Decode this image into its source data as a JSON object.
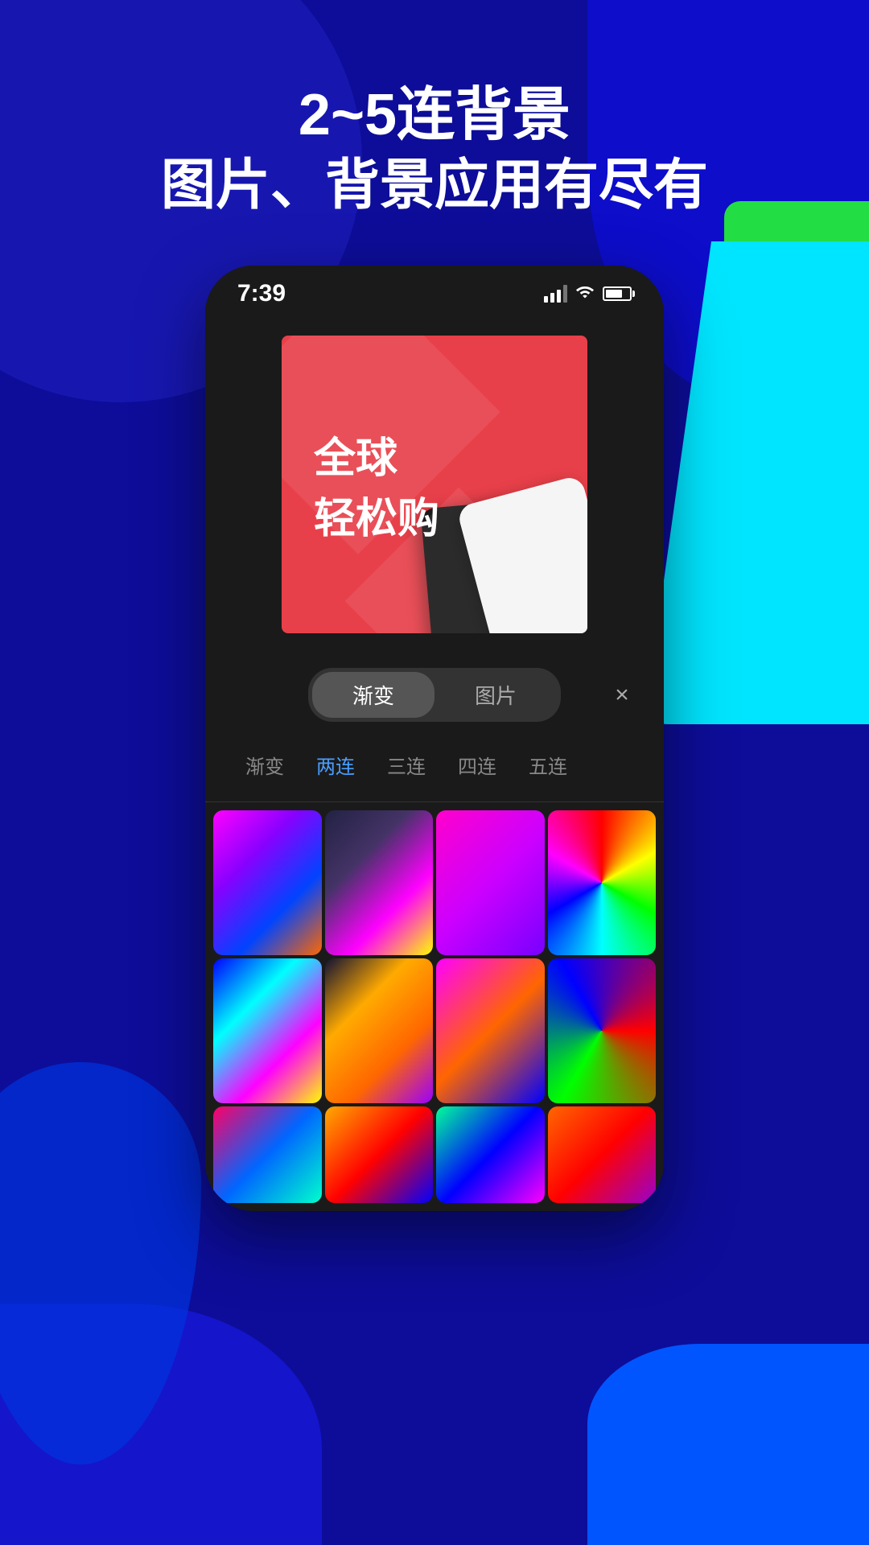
{
  "background": {
    "color": "#0d0d99"
  },
  "headline": {
    "line1": "2~5连背景",
    "line2": "图片、背景应用有尽有"
  },
  "phone": {
    "status_bar": {
      "time": "7:39",
      "signal": "signal",
      "wifi": "wifi",
      "battery": "battery"
    },
    "promo_card": {
      "line1": "全球",
      "line2": "轻松购"
    },
    "toolbar": {
      "tab1": "渐变",
      "tab2": "图片",
      "close": "×"
    },
    "filter_tabs": [
      {
        "label": "渐变",
        "active": false
      },
      {
        "label": "两连",
        "active": true
      },
      {
        "label": "三连",
        "active": false
      },
      {
        "label": "四连",
        "active": false
      },
      {
        "label": "五连",
        "active": false
      }
    ],
    "gradients": [
      {
        "id": "grad1"
      },
      {
        "id": "grad2"
      },
      {
        "id": "grad3"
      },
      {
        "id": "grad4"
      },
      {
        "id": "grad5"
      },
      {
        "id": "grad6"
      },
      {
        "id": "grad7"
      },
      {
        "id": "grad8"
      }
    ]
  }
}
